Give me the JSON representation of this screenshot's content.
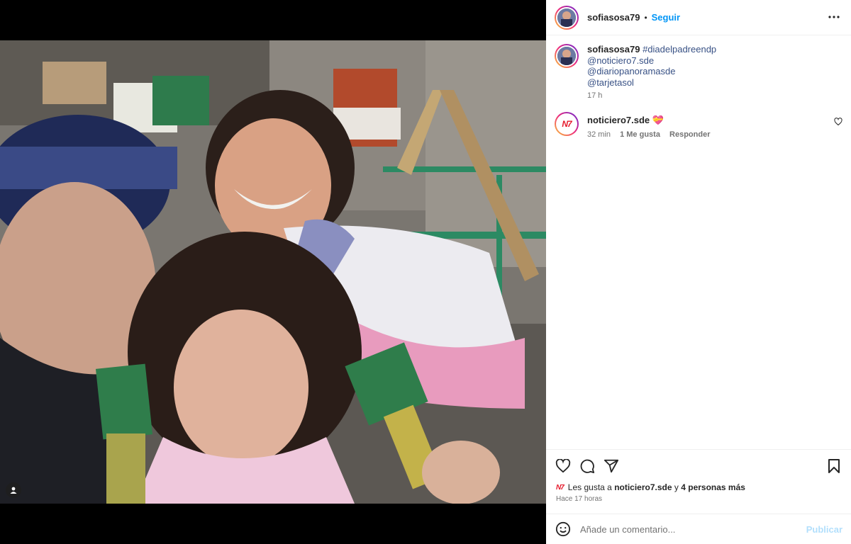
{
  "post": {
    "username": "sofiasosa79",
    "separator": "•",
    "follow_label": "Seguir",
    "more_icon": "more-options-icon"
  },
  "caption": {
    "username": "sofiasosa79",
    "hashtag": "#diadelpadreendp",
    "mentions": [
      "@noticiero7.sde",
      "@diariopanoramasde",
      "@tarjetasol"
    ],
    "time": "17 h"
  },
  "comment": {
    "avatar_text": "N7",
    "username": "noticiero7.sde",
    "emoji": "💝",
    "time": "32 min",
    "likes": "1 Me gusta",
    "reply": "Responder"
  },
  "likes_summary": {
    "prefix": "Les gusta a",
    "user": "noticiero7.sde",
    "middle": "y",
    "others": "4 personas más",
    "ago": "Hace 17 horas"
  },
  "comment_box": {
    "placeholder": "Añade un comentario...",
    "publish_label": "Publicar"
  },
  "colors": {
    "accent": "#0095f6",
    "link": "#385185",
    "brand_red": "#e5192b"
  }
}
